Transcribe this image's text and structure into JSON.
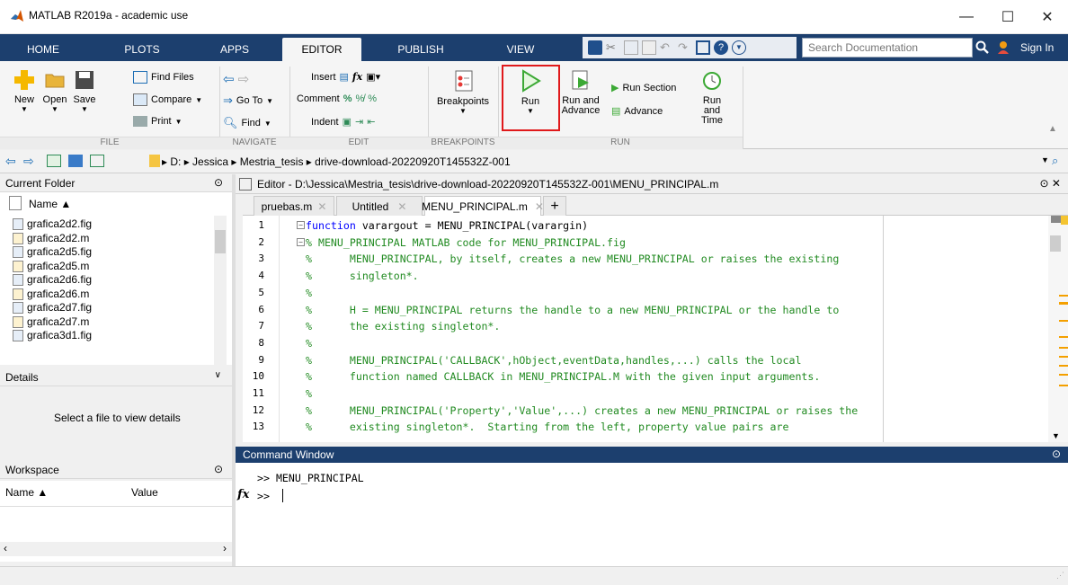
{
  "window": {
    "title": "MATLAB R2019a - academic use"
  },
  "ribbon_tabs": [
    {
      "label": "HOME"
    },
    {
      "label": "PLOTS"
    },
    {
      "label": "APPS"
    },
    {
      "label": "EDITOR"
    },
    {
      "label": "PUBLISH"
    },
    {
      "label": "VIEW"
    }
  ],
  "search": {
    "placeholder": "Search Documentation"
  },
  "signin": "Sign In",
  "file_section": {
    "new": "New",
    "open": "Open",
    "save": "Save",
    "find_files": "Find Files",
    "compare": "Compare",
    "print": "Print",
    "label": "FILE"
  },
  "navigate_section": {
    "goto": "Go To",
    "find": "Find",
    "label": "NAVIGATE"
  },
  "edit_section": {
    "insert": "Insert",
    "comment": "Comment",
    "indent": "Indent",
    "label": "EDIT"
  },
  "breakpoints_section": {
    "breakpoints": "Breakpoints",
    "label": "BREAKPOINTS"
  },
  "run_section": {
    "run": "Run",
    "run_and_advance_1": "Run and",
    "run_and_advance_2": "Advance",
    "run_section": "Run Section",
    "advance": "Advance",
    "run_and_time_1": "Run and",
    "run_and_time_2": "Time",
    "label": "RUN"
  },
  "address": {
    "path": "▸ D: ▸ Jessica ▸ Mestria_tesis ▸ drive-download-20220920T145532Z-001"
  },
  "current_folder": {
    "title": "Current Folder",
    "col_name": "Name ▲",
    "files": [
      "grafica2d2.fig",
      "grafica2d2.m",
      "grafica2d5.fig",
      "grafica2d5.m",
      "grafica2d6.fig",
      "grafica2d6.m",
      "grafica2d7.fig",
      "grafica2d7.m",
      "grafica3d1.fig"
    ]
  },
  "details": {
    "title": "Details",
    "message": "Select a file to view details"
  },
  "workspace": {
    "title": "Workspace",
    "col_name": "Name ▲",
    "col_value": "Value"
  },
  "editor": {
    "title": "Editor - D:\\Jessica\\Mestria_tesis\\drive-download-20220920T145532Z-001\\MENU_PRINCIPAL.m",
    "tabs": [
      "pruebas.m",
      "Untitled",
      "MENU_PRINCIPAL.m"
    ],
    "lines": [
      {
        "n": "1",
        "kw": "function",
        "rest": " varargout = MENU_PRINCIPAL(varargin)"
      },
      {
        "n": "2",
        "c": "% MENU_PRINCIPAL MATLAB code for MENU_PRINCIPAL.fig"
      },
      {
        "n": "3",
        "c": "%      MENU_PRINCIPAL, by itself, creates a new MENU_PRINCIPAL or raises the existing"
      },
      {
        "n": "4",
        "c": "%      singleton*."
      },
      {
        "n": "5",
        "c": "%"
      },
      {
        "n": "6",
        "c": "%      H = MENU_PRINCIPAL returns the handle to a new MENU_PRINCIPAL or the handle to"
      },
      {
        "n": "7",
        "c": "%      the existing singleton*."
      },
      {
        "n": "8",
        "c": "%"
      },
      {
        "n": "9",
        "c": "%      MENU_PRINCIPAL('CALLBACK',hObject,eventData,handles,...) calls the local"
      },
      {
        "n": "10",
        "c": "%      function named CALLBACK in MENU_PRINCIPAL.M with the given input arguments."
      },
      {
        "n": "11",
        "c": "%"
      },
      {
        "n": "12",
        "c": "%      MENU_PRINCIPAL('Property','Value',...) creates a new MENU_PRINCIPAL or raises the"
      },
      {
        "n": "13",
        "c": "%      existing singleton*.  Starting from the left, property value pairs are"
      }
    ]
  },
  "command_window": {
    "title": "Command Window",
    "line1": ">> MENU_PRINCIPAL",
    "prompt": ">>",
    "fx": "fx"
  }
}
